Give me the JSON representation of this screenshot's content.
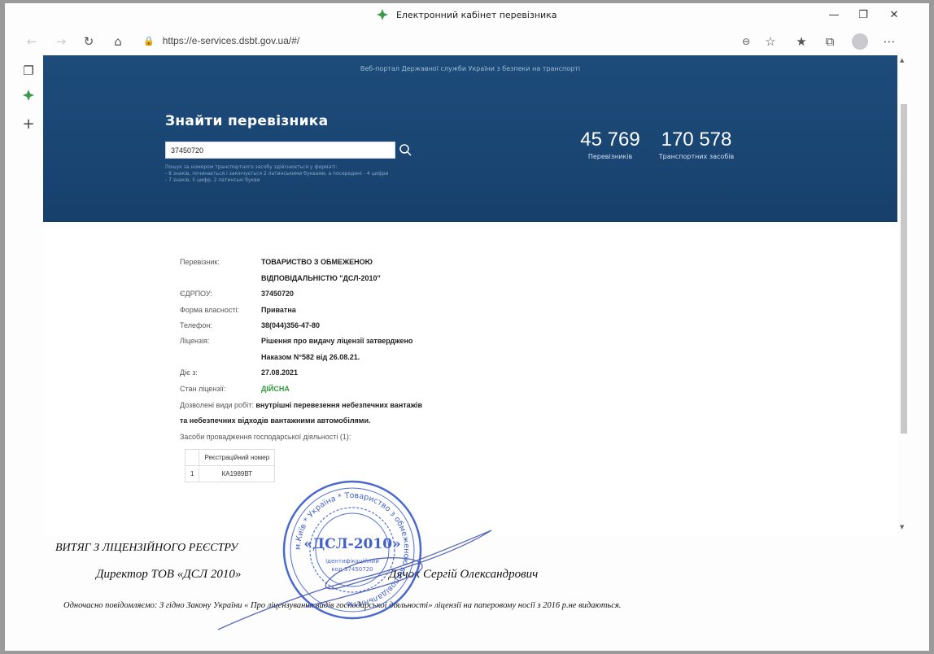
{
  "window": {
    "title": "Електронний кабінет перевізника"
  },
  "address_bar": {
    "url": "https://e-services.dsbt.gov.ua/#/"
  },
  "hero": {
    "subtitle": "Веб-портал Державної служби України з безпеки на транспорті",
    "find_title": "Знайти перевізника",
    "search_value": "37450720",
    "hint_lines": [
      "Пошук за номером транспортного засобу здійснюється у форматі:",
      "- 8 знаків, починається і закінчується 2 латинськими буквами, а посередині - 4 цифри",
      "- 7 знаків, 5 цифр, 2 латинські букви"
    ],
    "stats": [
      {
        "value": "45 769",
        "label": "Перевізників"
      },
      {
        "value": "170 578",
        "label": "Транспортних засобів"
      }
    ]
  },
  "carrier": {
    "carrier_label": "Перевізник:",
    "carrier_value_1": "ТОВАРИСТВО З ОБМЕЖЕНОЮ",
    "carrier_value_2": "ВІДПОВІДАЛЬНІСТЮ \"ДСЛ-2010\"",
    "edrpou_label": "ЄДРПОУ:",
    "edrpou_value": "37450720",
    "ownership_label": "Форма власності:",
    "ownership_value": "Приватна",
    "phone_label": "Телефон:",
    "phone_value": "38(044)356-47-80",
    "license_label": "Ліцензія:",
    "license_value_1": "Рішення про видачу ліцензії затверджено",
    "license_value_2": "Наказом N°582 від 26.08.21.",
    "valid_from_label": "Діє з:",
    "valid_from_value": "27.08.2021",
    "status_label": "Стан ліцензії:",
    "status_value": "ДІЙСНА",
    "works_label": "Дозволені види робіт:",
    "works_value_1": "внутрішні перевезення небезпечних вантажів",
    "works_value_2": "та небезпечних відходів вантажними автомобілями.",
    "vehicles_caption": "Засоби провадження господарської діяльності (1):"
  },
  "vehicles_table": {
    "header": "Реєстраційний номер",
    "rows": [
      {
        "index": "1",
        "plate": "КА1989ВТ"
      }
    ]
  },
  "document": {
    "heading": "ВИТЯГ З ЛІЦЕНЗІЙНОГО РЕЄСТРУ",
    "signer_title": "Директор ТОВ «ДСЛ 2010»",
    "signer_name": "Дячок Сергій Олександрович",
    "notice": "Одночасно повідомляємо: З гідно Закону України « Про ліцензування видів господарської діяльності» ліцензії на паперовому носії  з 2016 р.не видаються."
  },
  "stamp": {
    "center_text": "«ДСЛ-2010»",
    "code_text": "Ідентифікаційний код 37450720",
    "ring_text": "м.Київ * Україна * Товариство з обмеженою відповідальністю"
  },
  "colors": {
    "hero_blue": "#1a4573",
    "status_green": "#2e9a3a",
    "stamp_blue": "#2b4fc4"
  }
}
